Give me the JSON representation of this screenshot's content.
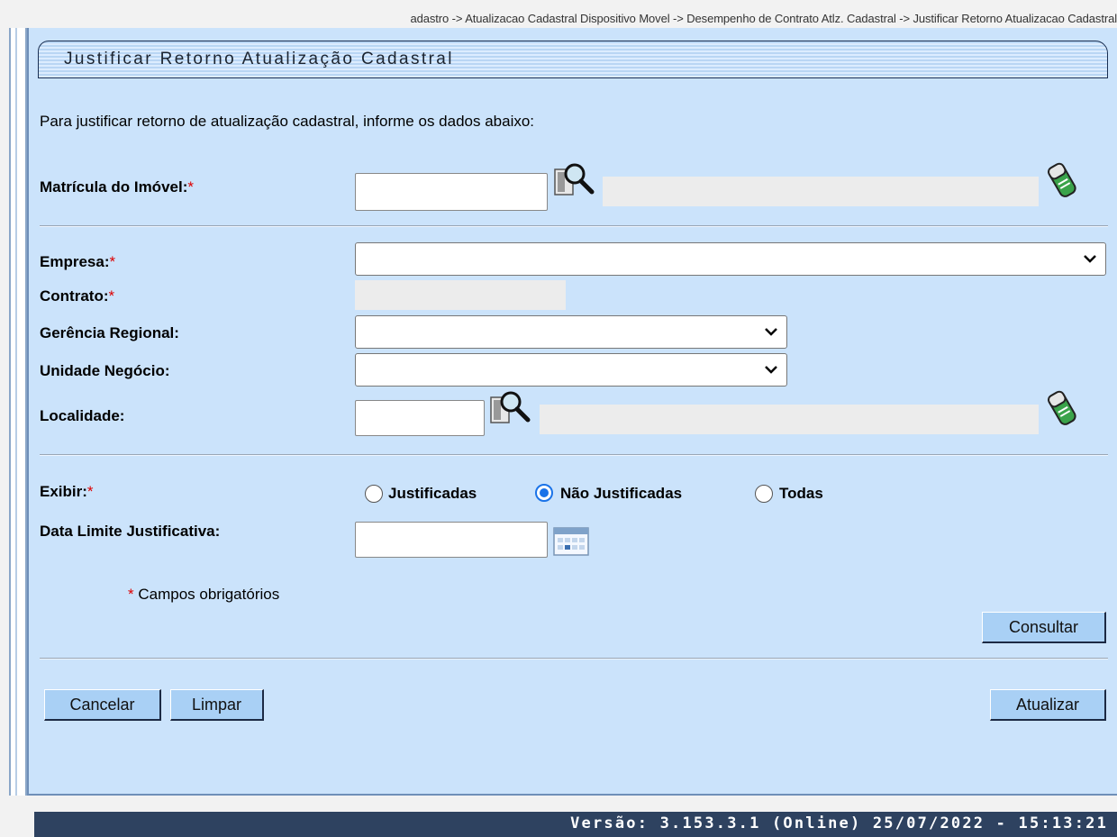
{
  "breadcrumb": "adastro -> Atualizacao Cadastral Dispositivo Movel -> Desempenho de Contrato Atlz. Cadastral -> Justificar Retorno Atualizacao Cadastral",
  "page_title": "Justificar Retorno Atualização Cadastral",
  "intro": "Para justificar retorno de atualização cadastral, informe os dados abaixo:",
  "required_mark": "*",
  "fields": {
    "matricula_label": "Matrícula do Imóvel:",
    "matricula_value": "",
    "empresa_label": "Empresa:",
    "empresa_value": "",
    "contrato_label": "Contrato:",
    "gerencia_label": "Gerência Regional:",
    "gerencia_value": "",
    "unidade_label": "Unidade Negócio:",
    "unidade_value": "",
    "localidade_label": "Localidade:",
    "localidade_value": "",
    "exibir_label": "Exibir:",
    "data_limite_label": "Data Limite Justificativa:",
    "data_limite_value": ""
  },
  "exibir_options": [
    {
      "label": "Justificadas",
      "selected": false
    },
    {
      "label": "Não Justificadas",
      "selected": true
    },
    {
      "label": "Todas",
      "selected": false
    }
  ],
  "required_note": "Campos obrigatórios",
  "buttons": {
    "consultar": "Consultar",
    "cancelar": "Cancelar",
    "limpar": "Limpar",
    "atualizar": "Atualizar"
  },
  "footer": "Versão: 3.153.3.1 (Online) 25/07/2022 - 15:13:21",
  "icons": [
    "search-icon",
    "eraser-icon",
    "calendar-icon",
    "chevron-down-icon"
  ]
}
